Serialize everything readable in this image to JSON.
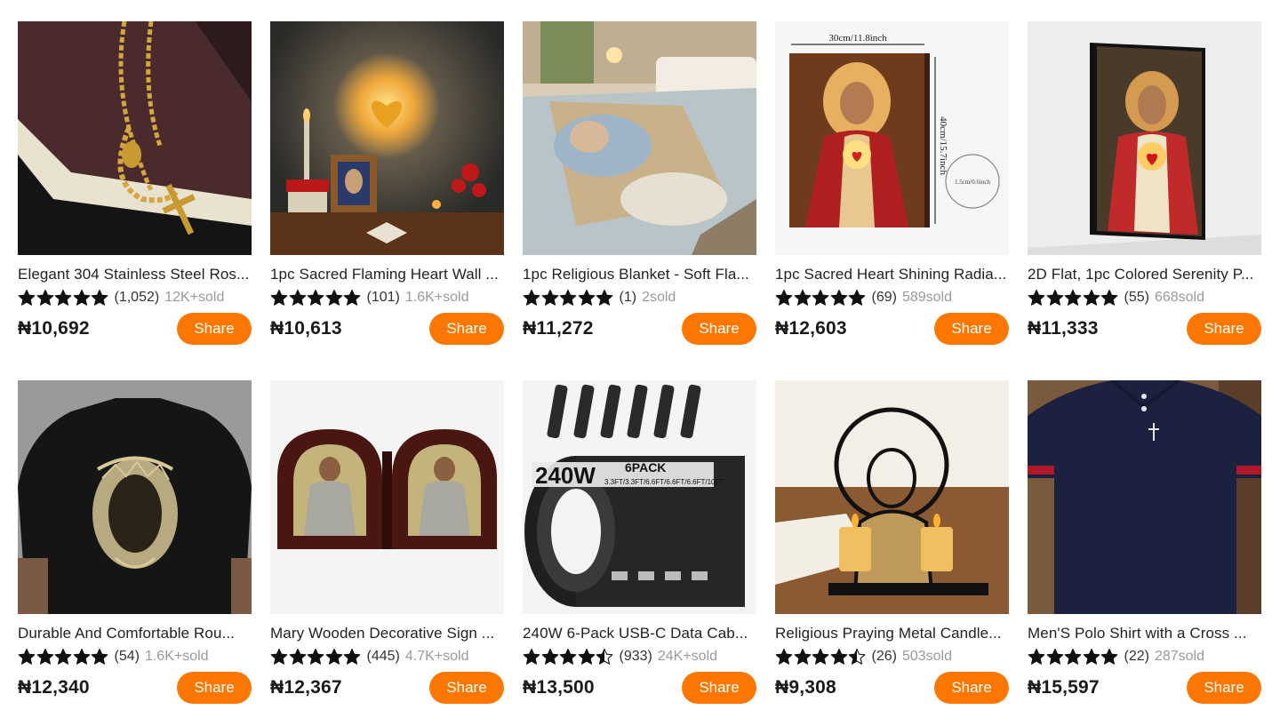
{
  "accent_color": "#fb7701",
  "products": [
    {
      "title": "Elegant 304 Stainless Steel Ros...",
      "rating": 5,
      "reviews": "(1,052)",
      "sold": "12K+sold",
      "price": "₦10,692",
      "share_label": "Share",
      "image": "rosary-on-book"
    },
    {
      "title": "1pc Sacred Flaming Heart Wall ...",
      "rating": 5,
      "reviews": "(101)",
      "sold": "1.6K+sold",
      "price": "₦10,613",
      "share_label": "Share",
      "image": "sacred-heart-wall-light"
    },
    {
      "title": "1pc Religious Blanket - Soft Fla...",
      "rating": 5,
      "reviews": "(1)",
      "sold": "2sold",
      "price": "₦11,272",
      "share_label": "Share",
      "image": "religious-blanket-on-bed"
    },
    {
      "title": "1pc Sacred Heart Shining Radia...",
      "rating": 5,
      "reviews": "(69)",
      "sold": "589sold",
      "price": "₦12,603",
      "share_label": "Share",
      "image": "sacred-heart-canvas-dimensions",
      "image_text": {
        "width": "30cm/11.8inch",
        "height": "40cm/15.7inch",
        "depth": "1.5cm/0.6inch"
      }
    },
    {
      "title": "2D Flat, 1pc Colored Serenity P...",
      "rating": 5,
      "reviews": "(55)",
      "sold": "668sold",
      "price": "₦11,333",
      "share_label": "Share",
      "image": "jesus-canvas-on-wall"
    },
    {
      "title": "Durable And Comfortable Rou...",
      "rating": 5,
      "reviews": "(54)",
      "sold": "1.6K+sold",
      "price": "₦12,340",
      "share_label": "Share",
      "image": "jesus-print-shirt"
    },
    {
      "title": "Mary Wooden Decorative Sign ...",
      "rating": 5,
      "reviews": "(445)",
      "sold": "4.7K+sold",
      "price": "₦12,367",
      "share_label": "Share",
      "image": "wooden-icon-diptych"
    },
    {
      "title": "240W 6-Pack USB-C Data Cab...",
      "rating": 4.5,
      "reviews": "(933)",
      "sold": "24K+sold",
      "price": "₦13,500",
      "share_label": "Share",
      "image": "usb-c-cables-6pack",
      "image_text": {
        "headline": "240W",
        "pack": "6PACK",
        "lengths": "3.3FT/3.3FT/6.6FT/6.6FT/6.6FT/10FT"
      }
    },
    {
      "title": "Religious Praying Metal Candle...",
      "rating": 4.5,
      "reviews": "(26)",
      "sold": "503sold",
      "price": "₦9,308",
      "share_label": "Share",
      "image": "praying-jesus-candle-holder"
    },
    {
      "title": "Men'S Polo Shirt with a Cross ...",
      "rating": 5,
      "reviews": "(22)",
      "sold": "287sold",
      "price": "₦15,597",
      "share_label": "Share",
      "image": "navy-polo-shirt-cross"
    }
  ]
}
